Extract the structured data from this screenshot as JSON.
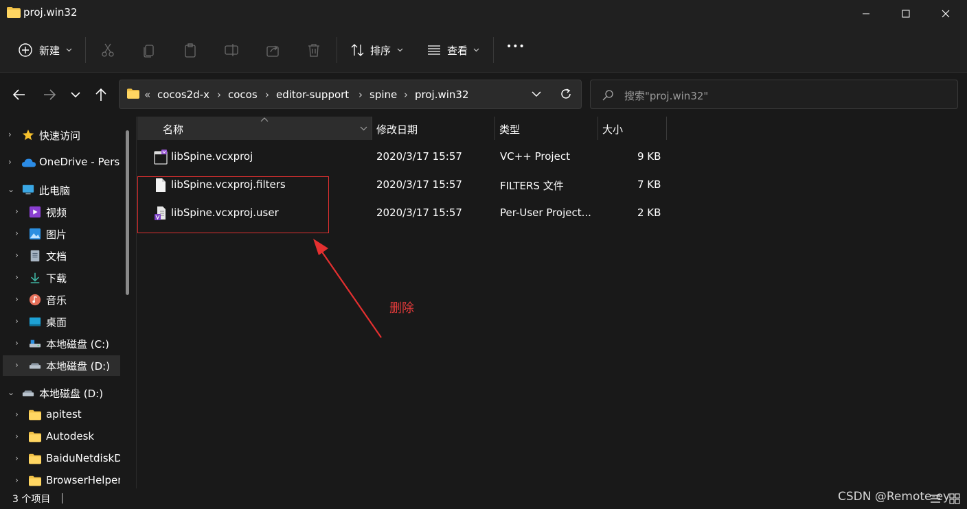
{
  "window": {
    "title": "proj.win32"
  },
  "toolbar": {
    "new_label": "新建",
    "sort_label": "排序",
    "view_label": "查看",
    "more_label": "•••"
  },
  "address": {
    "overflow": "«",
    "crumbs": [
      "cocos2d-x",
      "cocos",
      "editor-support",
      "spine",
      "proj.win32"
    ],
    "separator": "›"
  },
  "search": {
    "placeholder": "搜索\"proj.win32\""
  },
  "sidebar": {
    "items": [
      {
        "label": "快速访问",
        "icon": "star-icon"
      },
      {
        "label": "OneDrive - Perso",
        "icon": "cloud-icon"
      },
      {
        "label": "此电脑",
        "icon": "computer-icon"
      },
      {
        "label": "视频",
        "icon": "video-icon"
      },
      {
        "label": "图片",
        "icon": "pictures-icon"
      },
      {
        "label": "文档",
        "icon": "documents-icon"
      },
      {
        "label": "下载",
        "icon": "download-icon"
      },
      {
        "label": "音乐",
        "icon": "music-icon"
      },
      {
        "label": "桌面",
        "icon": "desktop-icon"
      },
      {
        "label": "本地磁盘 (C:)",
        "icon": "drive-icon"
      },
      {
        "label": "本地磁盘 (D:)",
        "icon": "drive-icon"
      },
      {
        "label": "本地磁盘 (D:)",
        "icon": "drive-icon"
      },
      {
        "label": "apitest",
        "icon": "folder-icon"
      },
      {
        "label": "Autodesk",
        "icon": "folder-icon"
      },
      {
        "label": "BaiduNetdiskD",
        "icon": "folder-icon"
      },
      {
        "label": "BrowserHelper",
        "icon": "folder-icon"
      }
    ]
  },
  "columns": {
    "name": "名称",
    "date": "修改日期",
    "type": "类型",
    "size": "大小"
  },
  "files": [
    {
      "name": "libSpine.vcxproj",
      "date": "2020/3/17 15:57",
      "type": "VC++ Project",
      "size": "9 KB",
      "icon": "vcxproj-icon"
    },
    {
      "name": "libSpine.vcxproj.filters",
      "date": "2020/3/17 15:57",
      "type": "FILTERS 文件",
      "size": "7 KB",
      "icon": "file-icon"
    },
    {
      "name": "libSpine.vcxproj.user",
      "date": "2020/3/17 15:57",
      "type": "Per-User Project...",
      "size": "2 KB",
      "icon": "user-project-icon"
    }
  ],
  "annotation": {
    "text": "删除",
    "color": "#e03030"
  },
  "status": {
    "item_count": "3 个项目"
  },
  "watermark": "CSDN @Remote-ey"
}
